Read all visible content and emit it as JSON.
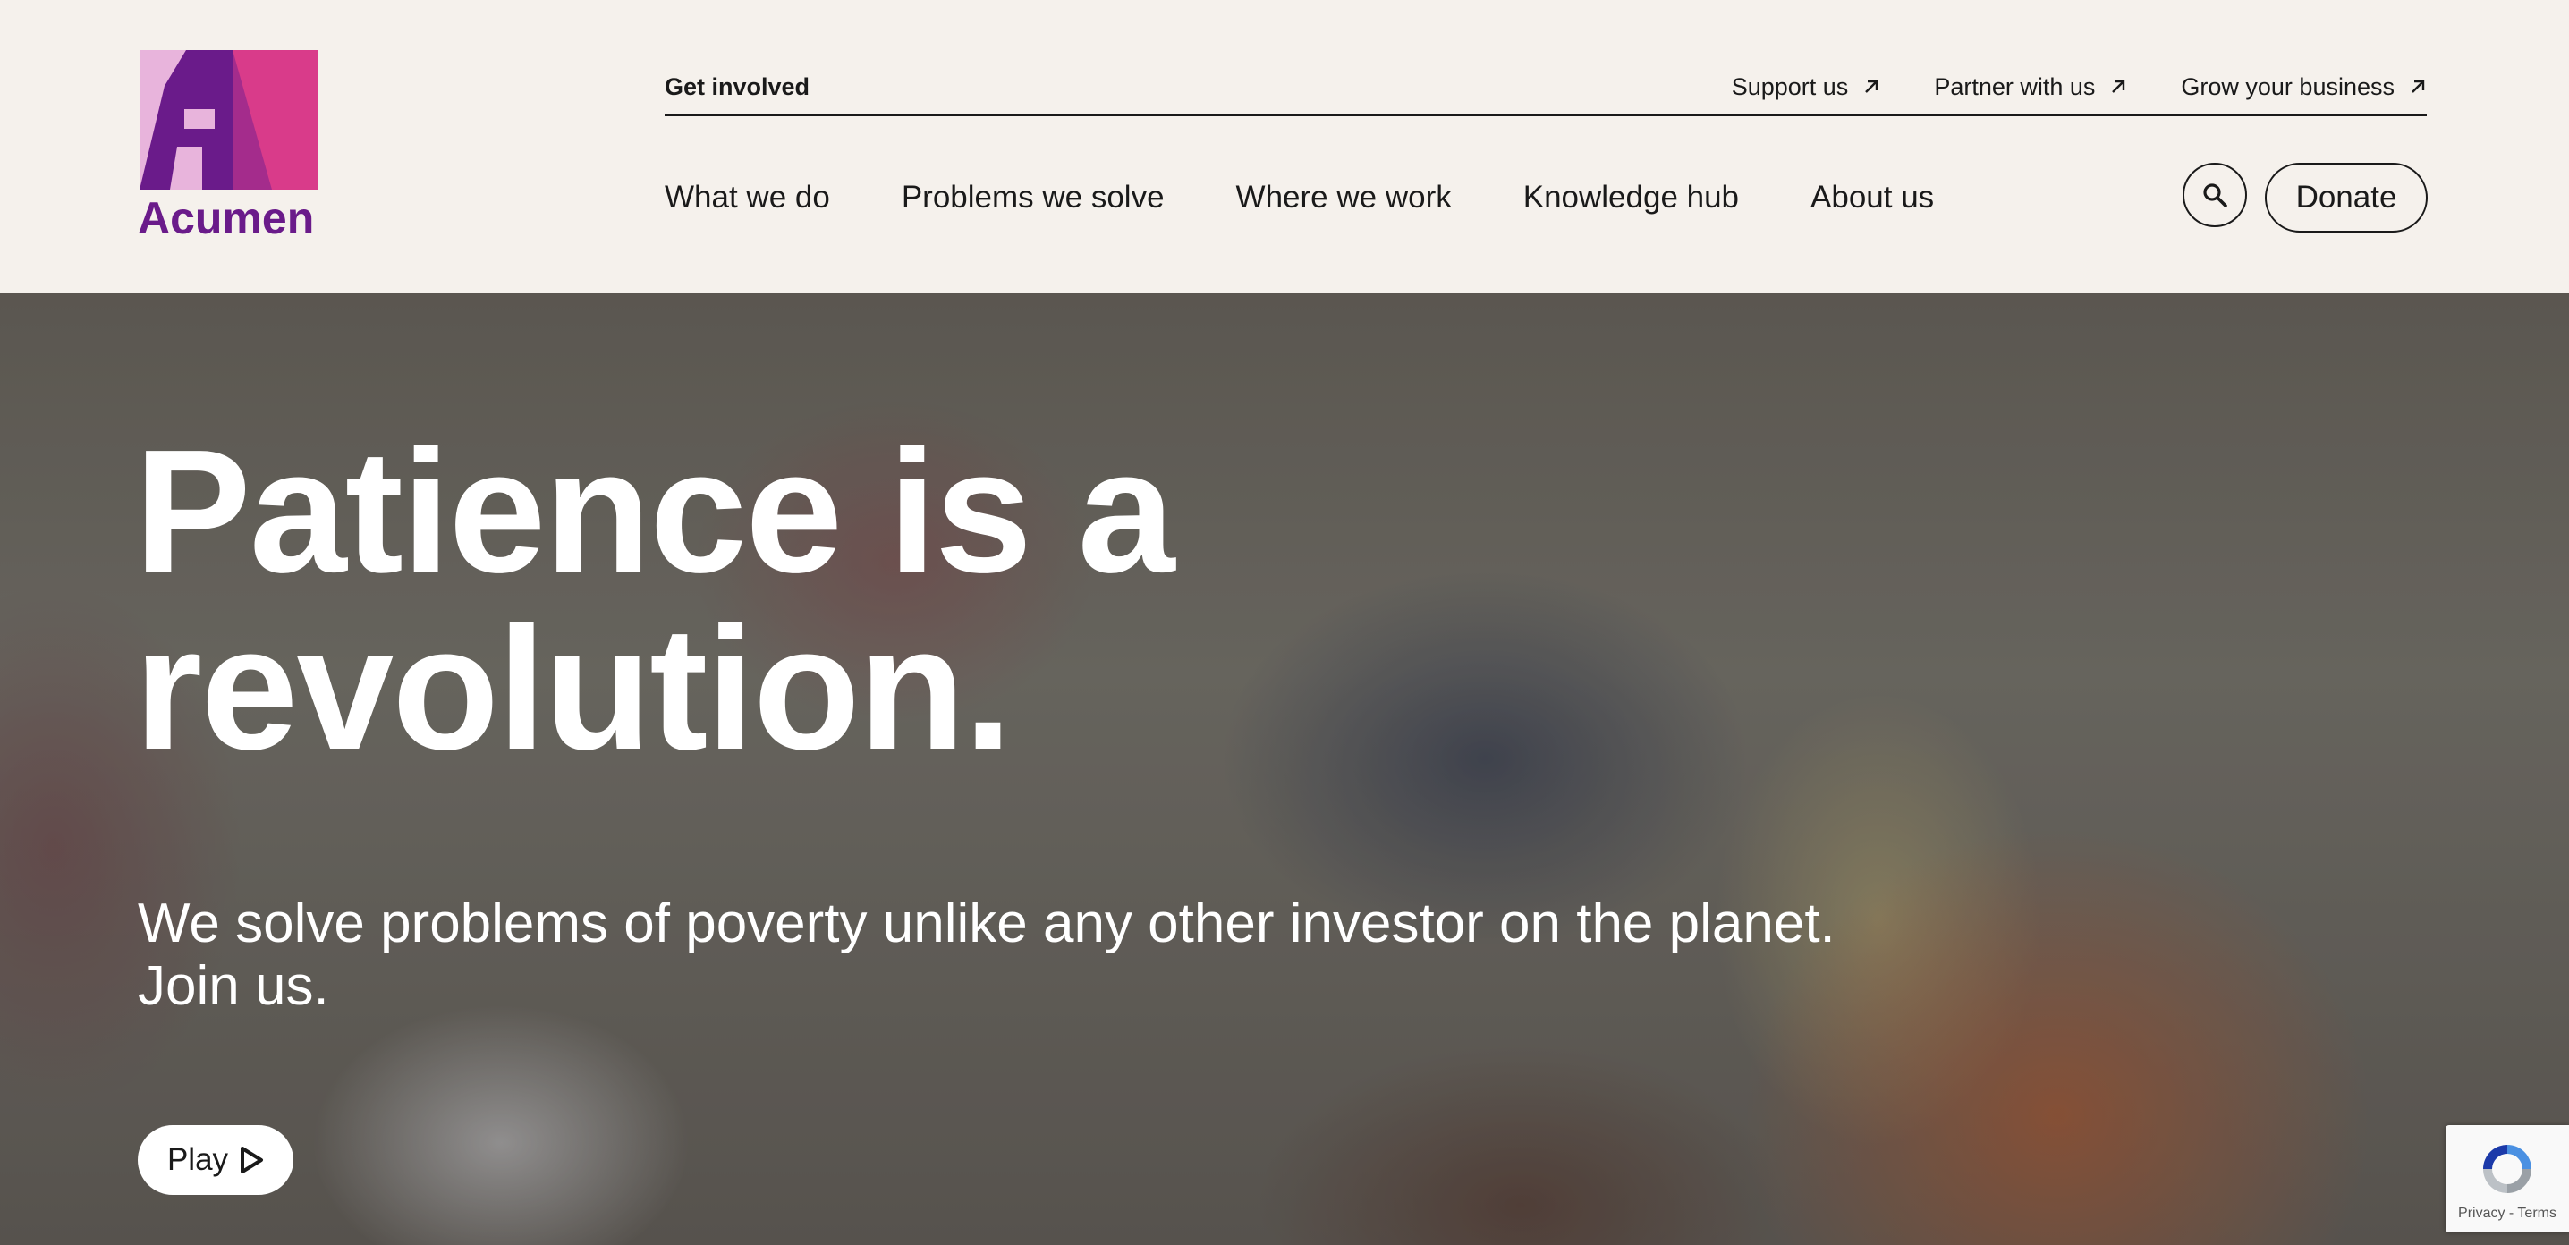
{
  "brand": {
    "name": "Acumen",
    "colors": {
      "purple": "#6a1b8a",
      "light_pink": "#e8b4dc",
      "magenta": "#d93b8a",
      "background": "#f5f1ec"
    }
  },
  "utility_nav": {
    "label": "Get involved",
    "links": [
      {
        "label": "Support us",
        "icon": "arrow-up-right-icon"
      },
      {
        "label": "Partner with us",
        "icon": "arrow-up-right-icon"
      },
      {
        "label": "Grow your business",
        "icon": "arrow-up-right-icon"
      }
    ]
  },
  "main_nav": {
    "items": [
      {
        "label": "What we do"
      },
      {
        "label": "Problems we solve"
      },
      {
        "label": "Where we work"
      },
      {
        "label": "Knowledge hub"
      },
      {
        "label": "About us"
      }
    ],
    "search_icon": "search-icon",
    "donate_label": "Donate"
  },
  "hero": {
    "title": "Patience is a revolution.",
    "subtitle": "We solve problems of poverty unlike any other investor on the planet. Join us.",
    "play_label": "Play",
    "play_icon": "play-icon"
  },
  "recaptcha": {
    "text": "Privacy - Terms"
  }
}
